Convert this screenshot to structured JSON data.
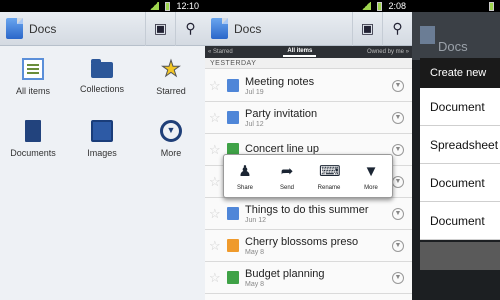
{
  "screen1": {
    "status": {
      "time": "12:10"
    },
    "appbar": {
      "title": "Docs",
      "new_icon": "new-doc-icon",
      "search_icon": "search-icon"
    },
    "grid": [
      {
        "label": "All items",
        "icon": "list-icon"
      },
      {
        "label": "Collections",
        "icon": "folder-icon"
      },
      {
        "label": "Starred",
        "icon": "star-icon"
      },
      {
        "label": "Documents",
        "icon": "document-icon"
      },
      {
        "label": "Images",
        "icon": "images-icon"
      },
      {
        "label": "More",
        "icon": "more-icon"
      }
    ]
  },
  "screen2": {
    "status": {
      "time": "2:08"
    },
    "appbar": {
      "title": "Docs"
    },
    "tabs": {
      "left": "« Starred",
      "active": "All items",
      "right": "Owned by me »"
    },
    "section": "YESTERDAY",
    "rows": [
      {
        "title": "Meeting notes",
        "date": "Jul 19",
        "type": "doc"
      },
      {
        "title": "Party invitation",
        "date": "Jul 12",
        "type": "doc"
      },
      {
        "title": "Concert line up",
        "date": "",
        "type": "sheet"
      },
      {
        "title": "",
        "date": "",
        "type": "doc"
      },
      {
        "title": "Things to do this summer",
        "date": "Jun 12",
        "type": "doc"
      },
      {
        "title": "Cherry blossoms preso",
        "date": "May 8",
        "type": "pres"
      },
      {
        "title": "Budget planning",
        "date": "May 8",
        "type": "sheet"
      }
    ],
    "popup": [
      {
        "label": "Share",
        "icon": "share-icon"
      },
      {
        "label": "Send",
        "icon": "send-icon"
      },
      {
        "label": "Rename",
        "icon": "rename-icon"
      },
      {
        "label": "More",
        "icon": "more-icon"
      }
    ]
  },
  "screen3": {
    "appbar": {
      "title": "Docs"
    },
    "dialog": {
      "title": "Create new",
      "options": [
        "Document",
        "Spreadsheet",
        "Document",
        "Document"
      ]
    }
  },
  "colors": {
    "doc": "#4f86d8",
    "sheet": "#3fa247",
    "pres": "#ef9a2c",
    "accent": "#9fd54e"
  }
}
